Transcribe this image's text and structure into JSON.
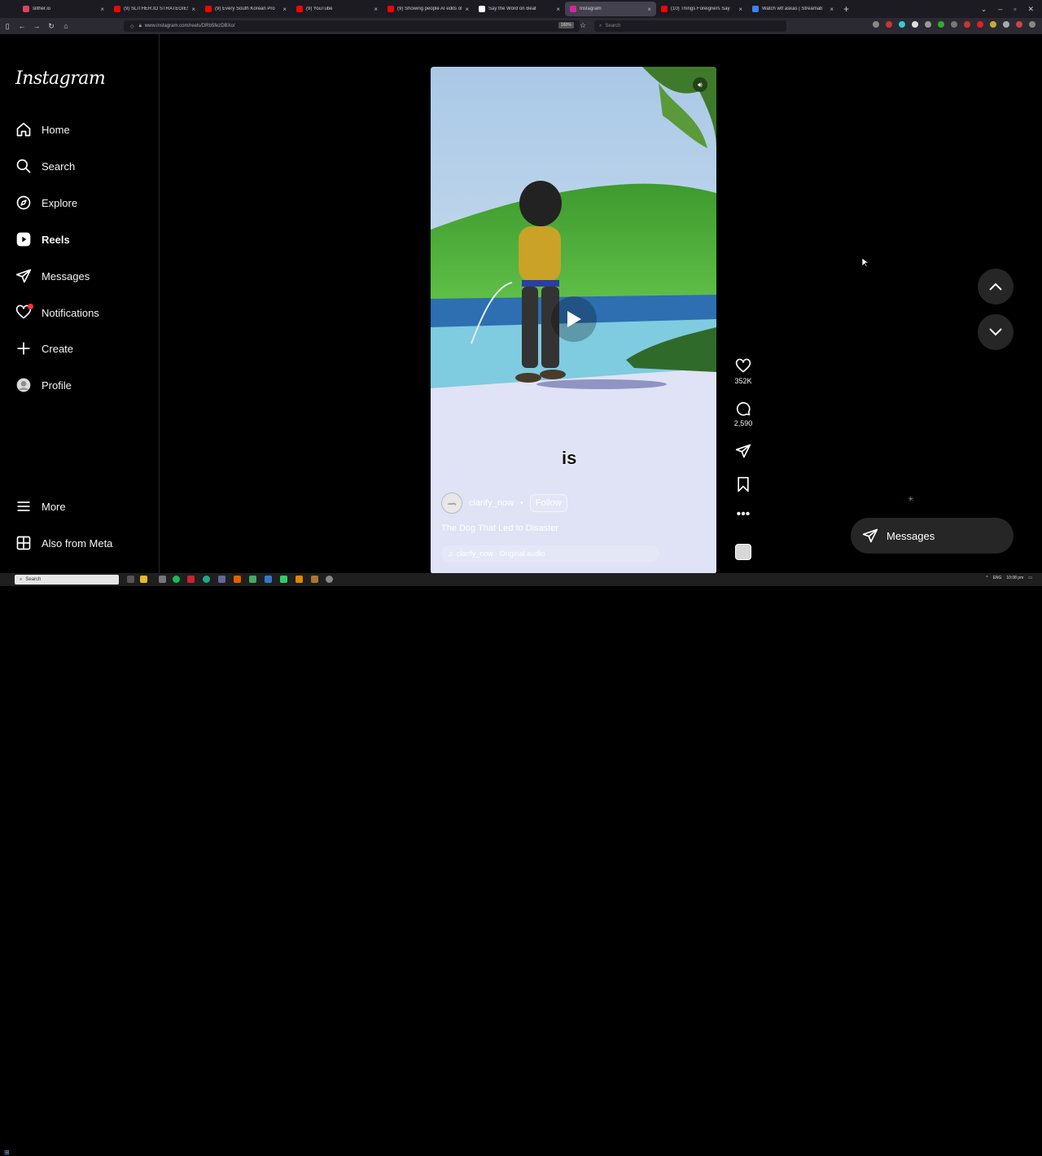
{
  "browser": {
    "tabs": [
      {
        "title": "slither.io",
        "color": "#e04060"
      },
      {
        "title": "(9) SLITHER.IO STRATEGIES, TIP",
        "color": "#ff0000"
      },
      {
        "title": "(9) Every South Korean Pro",
        "color": "#ff0000"
      },
      {
        "title": "(9) YouTube",
        "color": "#ff0000"
      },
      {
        "title": "(9) Showing people AI edits of",
        "color": "#ff0000"
      },
      {
        "title": "Say the Word on Beat",
        "color": "#ffffff"
      },
      {
        "title": "Instagram",
        "color": "#d6249f",
        "active": true
      },
      {
        "title": "(10) Things Foreigners Say",
        "color": "#ff0000"
      },
      {
        "title": "Watch wtf askas | Streamab",
        "color": "#3b82f6"
      }
    ],
    "url": "www.instagram.com/reels/DRb5fezDBXo/",
    "zoom": "160%",
    "search_placeholder": "Search"
  },
  "sidebar": {
    "logo": "Instagram",
    "items": [
      {
        "label": "Home",
        "icon": "home-icon"
      },
      {
        "label": "Search",
        "icon": "search-icon"
      },
      {
        "label": "Explore",
        "icon": "compass-icon"
      },
      {
        "label": "Reels",
        "icon": "reels-icon"
      },
      {
        "label": "Messages",
        "icon": "paper-plane-icon"
      },
      {
        "label": "Notifications",
        "icon": "heart-icon"
      },
      {
        "label": "Create",
        "icon": "plus-icon"
      },
      {
        "label": "Profile",
        "icon": "avatar-icon"
      }
    ],
    "more": "More",
    "also_from_meta": "Also from Meta"
  },
  "reel": {
    "overlay_text": "is",
    "username": "clarify_now",
    "separator": "•",
    "follow": "Follow",
    "title": "The Dog That Led to Disaster",
    "audio": "clarify_now · Original audio",
    "avatar_text": "clarify"
  },
  "actions": {
    "likes": "352K",
    "comments": "2,590"
  },
  "messages_button": "Messages",
  "taskbar": {
    "search": "Search",
    "lang": "ENG",
    "time": "10:08 pm"
  }
}
